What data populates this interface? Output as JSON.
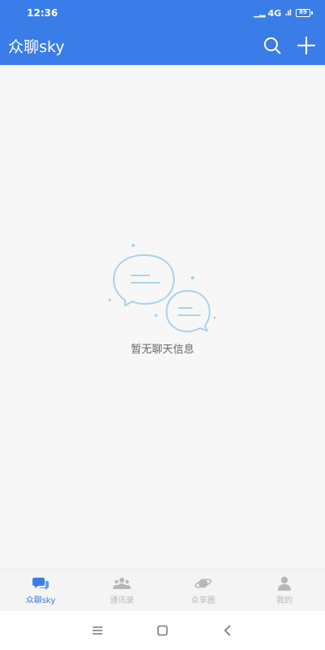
{
  "status_bar": {
    "time": "12:36",
    "network": "4G",
    "battery": "89"
  },
  "app_bar": {
    "title": "众聊sky",
    "icons": [
      "search-icon",
      "plus-icon"
    ]
  },
  "empty_state": {
    "message": "暂无聊天信息",
    "icon": "chat-bubbles-icon"
  },
  "tabs": [
    {
      "label": "众聊sky",
      "icon": "chat-icon",
      "active": true
    },
    {
      "label": "通讯录",
      "icon": "contacts-icon",
      "active": false
    },
    {
      "label": "众享圈",
      "icon": "planet-icon",
      "active": false
    },
    {
      "label": "我的",
      "icon": "person-icon",
      "active": false
    }
  ],
  "colors": {
    "primary": "#3a7de8",
    "background": "#f7f7f7",
    "tab_inactive": "#b8b8b8",
    "illustration": "#a8d3ec"
  }
}
